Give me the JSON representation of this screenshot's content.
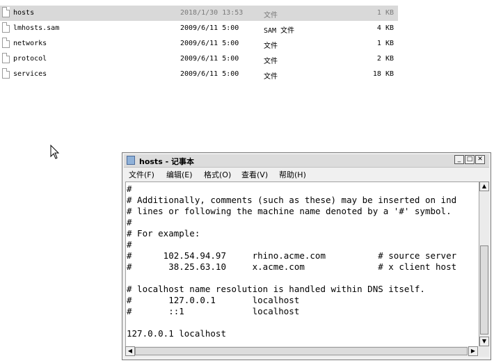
{
  "files": [
    {
      "name": "hosts",
      "date": "2018/1/30 13:53",
      "type": "文件",
      "size": "1 KB",
      "selected": true
    },
    {
      "name": "lmhosts.sam",
      "date": "2009/6/11 5:00",
      "type": "SAM 文件",
      "size": "4 KB",
      "selected": false
    },
    {
      "name": "networks",
      "date": "2009/6/11 5:00",
      "type": "文件",
      "size": "1 KB",
      "selected": false
    },
    {
      "name": "protocol",
      "date": "2009/6/11 5:00",
      "type": "文件",
      "size": "2 KB",
      "selected": false
    },
    {
      "name": "services",
      "date": "2009/6/11 5:00",
      "type": "文件",
      "size": "18 KB",
      "selected": false
    }
  ],
  "notepad": {
    "title": "hosts - 记事本",
    "buttons": {
      "minimize": "_",
      "maximize": "□",
      "close": "✕"
    },
    "menu": [
      "文件(F)",
      "编辑(E)",
      "格式(O)",
      "查看(V)",
      "帮助(H)"
    ],
    "content": "#\n# Additionally, comments (such as these) may be inserted on ind\n# lines or following the machine name denoted by a '#' symbol.\n#\n# For example:\n#\n#      102.54.94.97     rhino.acme.com          # source server\n#       38.25.63.10     x.acme.com              # x client host\n\n# localhost name resolution is handled within DNS itself.\n#\t127.0.0.1       localhost\n#\t::1             localhost\n\n127.0.0.1 localhost"
  }
}
